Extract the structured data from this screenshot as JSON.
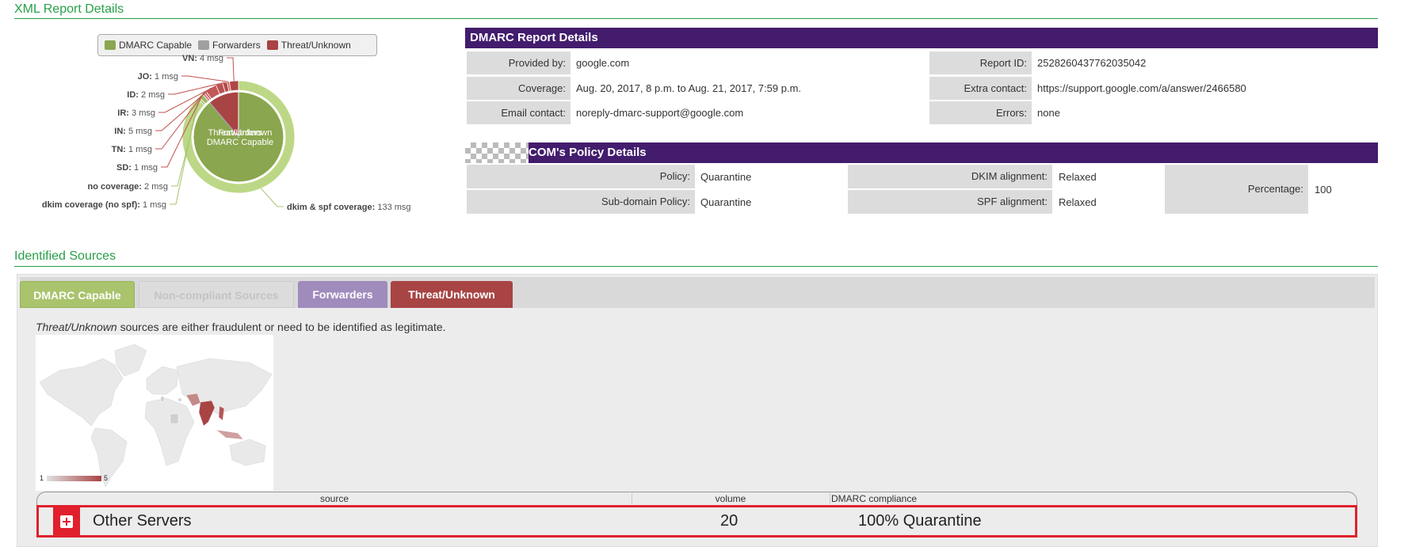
{
  "xml_section": {
    "title": "XML Report Details"
  },
  "chart_data": {
    "type": "pie",
    "legend": [
      {
        "name": "DMARC Capable",
        "color": "#8aa64e"
      },
      {
        "name": "Forwarders",
        "color": "#a0a0a0"
      },
      {
        "name": "Threat/Unknown",
        "color": "#a84444"
      }
    ],
    "legend_position": "top",
    "inner_labels": [
      "Threat/Unknown",
      "Forwarders",
      "DMARC Capable"
    ],
    "outer_slices": [
      {
        "label": "dkim & spf coverage",
        "value": 133,
        "unit": "msg",
        "group": "DMARC Capable",
        "color": "#bcd886"
      },
      {
        "label": "dkim coverage (no spf)",
        "value": 1,
        "unit": "msg",
        "group": "DMARC Capable",
        "color": "#a8c46e"
      },
      {
        "label": "no coverage",
        "value": 2,
        "unit": "msg",
        "group": "DMARC Capable",
        "color": "#9cb860"
      },
      {
        "label": "SD",
        "value": 1,
        "unit": "msg",
        "group": "Threat/Unknown",
        "color": "#d47070"
      },
      {
        "label": "TN",
        "value": 1,
        "unit": "msg",
        "group": "Threat/Unknown",
        "color": "#c86262"
      },
      {
        "label": "IN",
        "value": 5,
        "unit": "msg",
        "group": "Threat/Unknown",
        "color": "#c25858"
      },
      {
        "label": "IR",
        "value": 3,
        "unit": "msg",
        "group": "Threat/Unknown",
        "color": "#bb5050"
      },
      {
        "label": "ID",
        "value": 2,
        "unit": "msg",
        "group": "Threat/Unknown",
        "color": "#b44a4a"
      },
      {
        "label": "JO",
        "value": 1,
        "unit": "msg",
        "group": "Threat/Unknown",
        "color": "#c86262"
      },
      {
        "label": "VN",
        "value": 4,
        "unit": "msg",
        "group": "Threat/Unknown",
        "color": "#b04646"
      }
    ]
  },
  "report": {
    "title": "DMARC Report Details",
    "rows": [
      {
        "label": "Provided by:",
        "value": "google.com",
        "label2": "Report ID:",
        "value2": "2528260437762035042"
      },
      {
        "label": "Coverage:",
        "value": "Aug. 20, 2017, 8 p.m. to Aug. 21, 2017, 7:59 p.m.",
        "label2": "Extra contact:",
        "value2": "https://support.google.com/a/answer/2466580"
      },
      {
        "label": "Email contact:",
        "value": "noreply-dmarc-support@google.com",
        "label2": "Errors:",
        "value2": "none"
      }
    ]
  },
  "policy": {
    "title": "COM's Policy Details",
    "policy_label": "Policy:",
    "policy": "Quarantine",
    "subdomain_label": "Sub-domain Policy:",
    "subdomain": "Quarantine",
    "dkim_label": "DKIM alignment:",
    "dkim": "Relaxed",
    "spf_label": "SPF alignment:",
    "spf": "Relaxed",
    "percentage_label": "Percentage:",
    "percentage": "100"
  },
  "sources": {
    "title": "Identified Sources",
    "tabs": [
      {
        "label": "DMARC Capable",
        "color": "#a9c46c"
      },
      {
        "label": "Non-compliant Sources",
        "color": "#dcdcdc"
      },
      {
        "label": "Forwarders",
        "color": "#a08bbd"
      },
      {
        "label": "Threat/Unknown",
        "color": "#a84444",
        "active": true
      }
    ],
    "description_em": "Threat/Unknown",
    "description_rest": " sources are either fraudulent or need to be identified as legitimate.",
    "map_scale": {
      "min": "1",
      "max": "5"
    },
    "highlighted_countries": [
      "IN",
      "VN",
      "IR",
      "ID",
      "SD",
      "TN",
      "JO"
    ],
    "table": {
      "headers": [
        "source",
        "volume",
        "DMARC compliance"
      ],
      "rows": [
        {
          "source": "Other Servers",
          "volume": "20",
          "compliance": "100% Quarantine"
        }
      ]
    }
  }
}
